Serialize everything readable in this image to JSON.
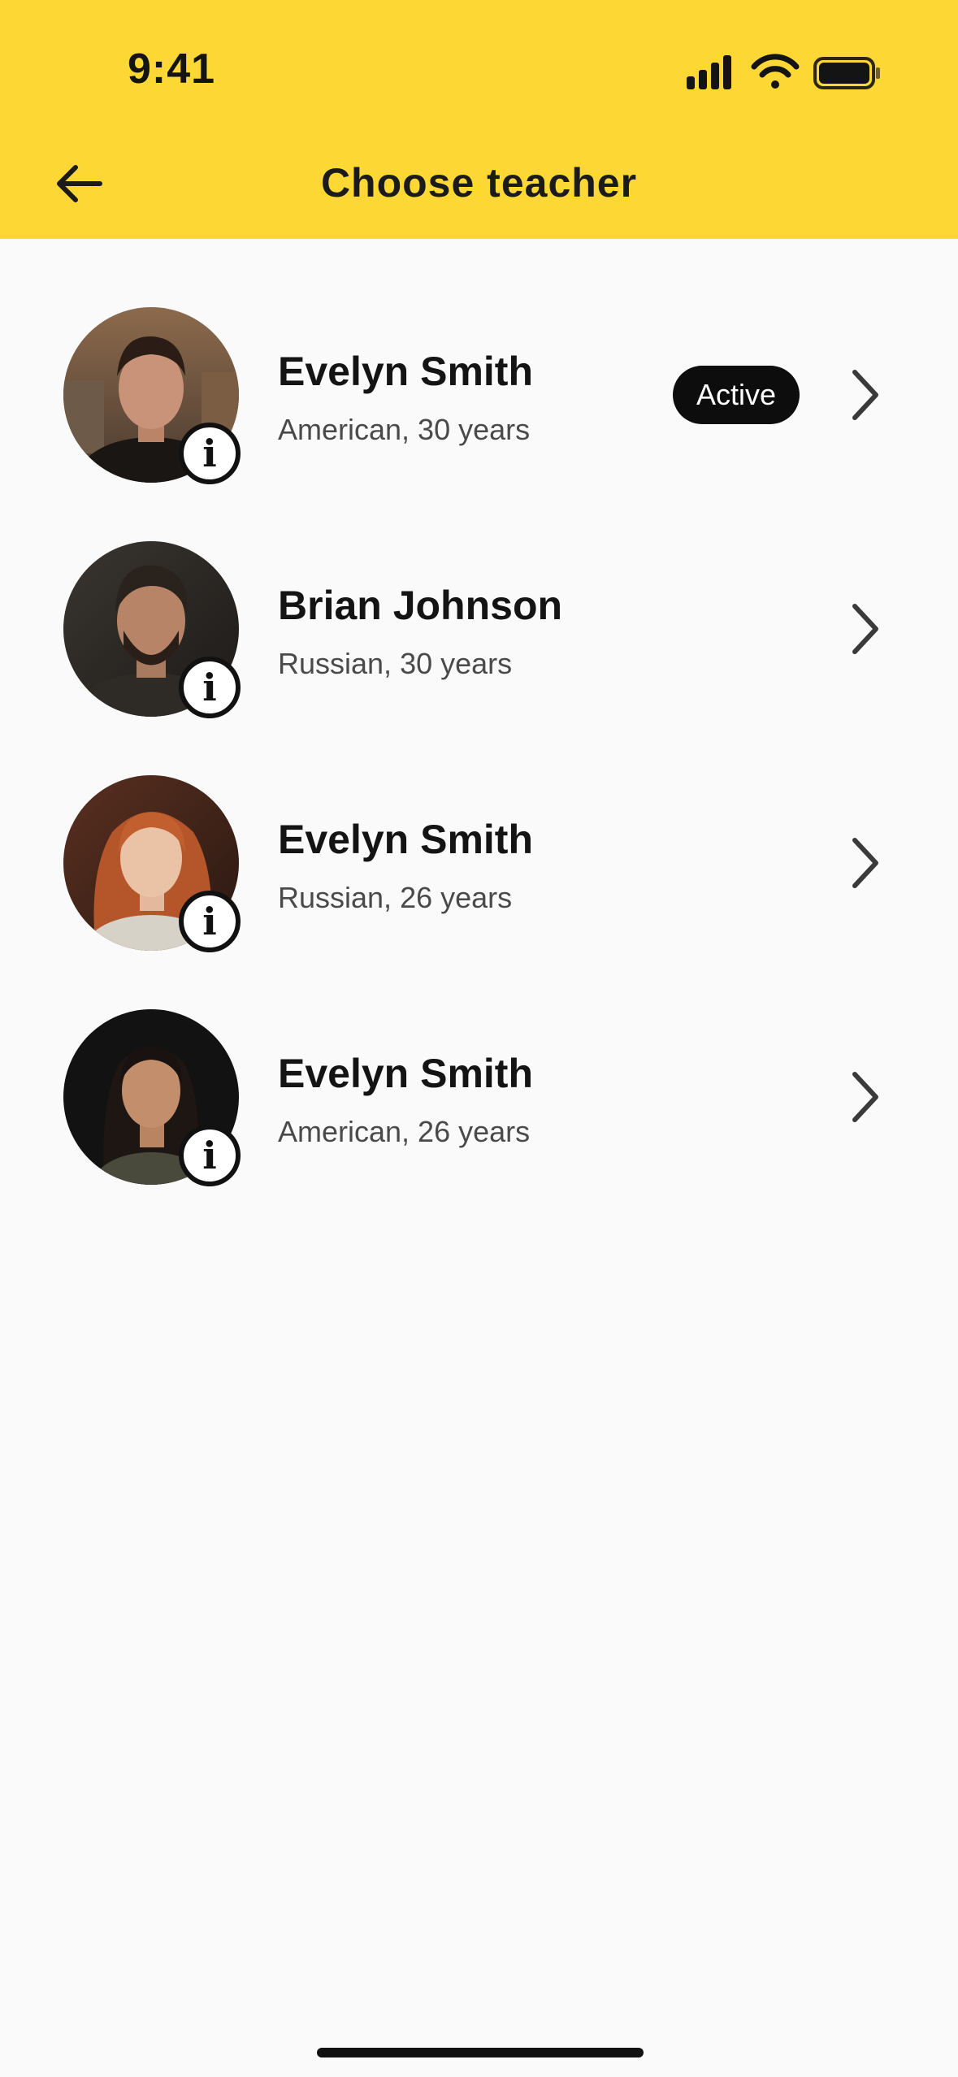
{
  "status_bar": {
    "time": "9:41"
  },
  "header": {
    "title": "Choose teacher",
    "back_icon": "arrow-left-icon"
  },
  "colors": {
    "header_bg": "#fdd835",
    "background": "#fafafa",
    "badge_bg": "#0d0d0d"
  },
  "teachers": [
    {
      "name": "Evelyn Smith",
      "meta": "American, 30 years",
      "status": "Active"
    },
    {
      "name": "Brian Johnson",
      "meta": "Russian, 30 years",
      "status": null
    },
    {
      "name": "Evelyn Smith",
      "meta": "Russian, 26 years",
      "status": null
    },
    {
      "name": "Evelyn Smith",
      "meta": "American, 26 years",
      "status": null
    }
  ],
  "icons": {
    "info": "info-icon",
    "chevron": "chevron-right-icon"
  }
}
